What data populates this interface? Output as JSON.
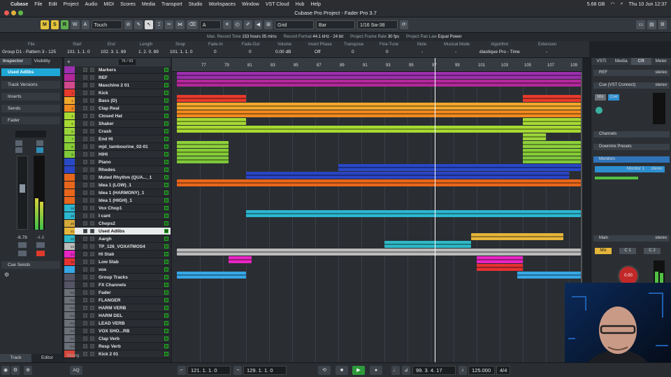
{
  "menubar": {
    "apple": "",
    "app": "Cubase",
    "items": [
      "File",
      "Edit",
      "Project",
      "Audio",
      "MIDI",
      "Scores",
      "Media",
      "Transport",
      "Studio",
      "Workspaces",
      "Window",
      "VST Cloud",
      "Hub",
      "Help"
    ],
    "memory": "5.68 GB",
    "clock": "Thu 10 Jun  12:37"
  },
  "window": {
    "title": "Cubase Pro Project - Fader Pro 3.7"
  },
  "toolbar": {
    "mode_buttons": [
      "M",
      "S",
      "R",
      "W",
      "A"
    ],
    "automation_mode": "Touch",
    "snap_type": "Grid",
    "grid_type": "Bar",
    "quantize": "1/16 Sw-38",
    "grid_a": "A"
  },
  "statusline": {
    "items": [
      {
        "k": "Max. Record Time",
        "v": "153 hours 05 mins"
      },
      {
        "k": "Record Format",
        "v": "44.1 kHz - 24 bit"
      },
      {
        "k": "Project Frame Rate",
        "v": "30 fps"
      },
      {
        "k": "Project Pan Law",
        "v": "Equal Power"
      }
    ]
  },
  "infoline": {
    "left_top": "File",
    "left_bottom": "Group D1 - Pattern 3 - 125",
    "fields": [
      {
        "h": "Start",
        "v": "101. 1. 1. 0"
      },
      {
        "h": "End",
        "v": "102. 3. 1. 89"
      },
      {
        "h": "Length",
        "v": "1. 2. 0. 89"
      },
      {
        "h": "Snap",
        "v": "101. 1. 1. 0"
      },
      {
        "h": "Fade-In",
        "v": "0"
      },
      {
        "h": "Fade-Out",
        "v": "0"
      },
      {
        "h": "Volume",
        "v": "0.00 dB"
      },
      {
        "h": "Invert Phase",
        "v": "Off"
      },
      {
        "h": "Transpose",
        "v": "0"
      },
      {
        "h": "Fine-Tune",
        "v": "0"
      },
      {
        "h": "Mute",
        "v": "-"
      },
      {
        "h": "Musical Mode",
        "v": "-"
      },
      {
        "h": "Algorithm",
        "v": "élastique Pro - Time"
      },
      {
        "h": "Extension",
        "v": "-"
      }
    ]
  },
  "inspector": {
    "tabs": [
      "Inspector",
      "Visibility"
    ],
    "track_name": "Used Adlibs",
    "sections": [
      "Track Versions",
      "Inserts",
      "Sends",
      "Fader",
      "Cue Sends"
    ],
    "fader_left": "-6.78",
    "fader_right": "-4.8",
    "bottom_tabs": [
      "Track",
      "Editor"
    ]
  },
  "tracklist": {
    "zoom": "76 / 93",
    "tracks": [
      {
        "n": "",
        "name": "Markers",
        "c": "#9b2fae"
      },
      {
        "n": "",
        "name": "REF",
        "c": "#b3279a"
      },
      {
        "n": "",
        "name": "Maschine 2 01",
        "c": "#d14a8b"
      },
      {
        "n": "1",
        "name": "Kick",
        "c": "#e83a2c"
      },
      {
        "n": "2",
        "name": "Bass (D)",
        "c": "#f1a72a"
      },
      {
        "n": "3",
        "name": "Clap Real",
        "c": "#f0891e"
      },
      {
        "n": "4",
        "name": "Closed Hat",
        "c": "#a7d933"
      },
      {
        "n": "5",
        "name": "Shaker",
        "c": "#a7d933"
      },
      {
        "n": "6",
        "name": "Crash",
        "c": "#9ad339"
      },
      {
        "n": "7",
        "name": "End Hi",
        "c": "#8fd13b"
      },
      {
        "n": "8",
        "name": "mjd_tambourine_02-01",
        "c": "#86cc35"
      },
      {
        "n": "9",
        "name": "HiHI",
        "c": "#7fc83a"
      },
      {
        "n": "",
        "name": "Piano",
        "c": "#2948c8"
      },
      {
        "n": "",
        "name": "Rhodes",
        "c": "#2a44c4"
      },
      {
        "n": "",
        "name": "Muted Rhythm (QUA..._1",
        "c": "#e8661c"
      },
      {
        "n": "",
        "name": "Idea 1 (LOW)_1",
        "c": "#e8661c"
      },
      {
        "n": "",
        "name": "Idea 1 (HARMONY)_1",
        "c": "#e8661c"
      },
      {
        "n": "",
        "name": "Idea 1 (HIGH)_1",
        "c": "#e8661c"
      },
      {
        "n": "18",
        "name": "Vox Chop1",
        "c": "#2cb6d0"
      },
      {
        "n": "19",
        "name": "I cant",
        "c": "#2cb6d0"
      },
      {
        "n": "20",
        "name": "Chops2",
        "c": "#d3a93a"
      },
      {
        "n": "21",
        "name": "Used Adlibs",
        "c": "#e6b53a"
      },
      {
        "n": "22",
        "name": "Aargh",
        "c": "#2fb8c8"
      },
      {
        "n": "23",
        "name": "TP_126_VOXATMOS4",
        "c": "#bbbbbb"
      },
      {
        "n": "24",
        "name": "Hi Stab",
        "c": "#e824c2"
      },
      {
        "n": "25",
        "name": "Low Stab",
        "c": "#e63232"
      },
      {
        "n": "",
        "name": "vox",
        "c": "#36a7e6"
      },
      {
        "n": "",
        "name": "Group Tracks",
        "c": "#556"
      },
      {
        "n": "",
        "name": "FX Channels",
        "c": "#556"
      },
      {
        "n": "FX 56",
        "name": "Fader",
        "c": "#6a6f78"
      },
      {
        "n": "FX 57",
        "name": "FLANGER",
        "c": "#6a6f78"
      },
      {
        "n": "FX 58",
        "name": "HARM VERB",
        "c": "#6a6f78"
      },
      {
        "n": "FX 59",
        "name": "HARM DEL",
        "c": "#6a6f78"
      },
      {
        "n": "FX 60",
        "name": "LEAD VERB",
        "c": "#6a6f78"
      },
      {
        "n": "FX 61",
        "name": "VOX SHO...RB",
        "c": "#6a6f78"
      },
      {
        "n": "FX 62",
        "name": "Clap Verb",
        "c": "#6a6f78"
      },
      {
        "n": "FX 63",
        "name": "Resp Verb",
        "c": "#6a6f78"
      },
      {
        "n": "",
        "name": "Kick 2 01",
        "c": "#d9463a"
      }
    ],
    "footer": "Mixing"
  },
  "ruler": {
    "bars": [
      "77",
      "79",
      "81",
      "83",
      "85",
      "87",
      "89",
      "91",
      "93",
      "95",
      "97",
      "99",
      "101",
      "103",
      "105",
      "107",
      "109",
      "111"
    ]
  },
  "rpanel": {
    "tabs": [
      "VSTi",
      "Media",
      "CR",
      "Meter"
    ],
    "ref": "REF",
    "ref_fmt": "stereo",
    "cue": "Cue (VST Connect)",
    "cue_fmt": "stereo",
    "mix": "Mix",
    "cue_btn": "Cue",
    "sections": [
      "Channels",
      "Downmix Presets",
      "Monitors"
    ],
    "monitor": "Monitor 1",
    "monitor_fmt": "stereo",
    "main": "Main",
    "main_fmt": "stereo",
    "main_btns": [
      "Mix",
      "C 1",
      "C 2"
    ],
    "knob": "0.00"
  },
  "transport": {
    "left_loc": "121. 1. 1. 0",
    "right_loc": "129. 1. 1. 0",
    "position": "99. 3. 4. 17",
    "tempo": "125.000",
    "signature": "4/4",
    "aq": "AQ"
  }
}
